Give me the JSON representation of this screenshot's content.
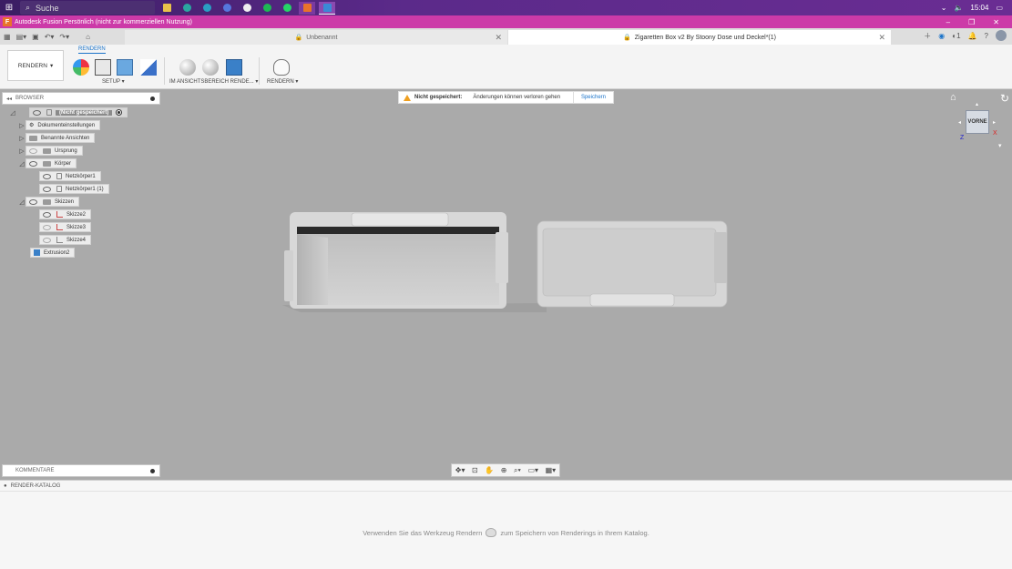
{
  "taskbar": {
    "search_placeholder": "Suche",
    "time": "15:04"
  },
  "titlebar": {
    "title": "Autodesk Fusion Persönlich (nicht zur kommerziellen Nutzung)",
    "logo_letter": "F"
  },
  "tabs": [
    {
      "label": "Unbenannt",
      "active": false
    },
    {
      "label": "Zigaretten Box v2 By Stoony Dose und Deckel*(1)",
      "active": true
    }
  ],
  "tabbar_right": {
    "notification_count": "1"
  },
  "ribbon": {
    "workspace_label": "RENDERN",
    "active_tab": "RENDERN",
    "groups": [
      {
        "label": "SETUP"
      },
      {
        "label": "IM ANSICHTSBEREICH RENDE..."
      },
      {
        "label": "RENDERN"
      }
    ]
  },
  "browser": {
    "header": "BROWSER",
    "items": [
      {
        "label": "(Nicht gespeichert)"
      },
      {
        "label": "Dokumenteinstellungen"
      },
      {
        "label": "Benannte Ansichten"
      },
      {
        "label": "Ursprung"
      },
      {
        "label": "Körper"
      },
      {
        "label": "Netzkörper1"
      },
      {
        "label": "Netzkörper1 (1)"
      },
      {
        "label": "Skizzen"
      },
      {
        "label": "Skizze2"
      },
      {
        "label": "Skizze3"
      },
      {
        "label": "Skizze4"
      },
      {
        "label": "Extrusion2"
      }
    ]
  },
  "warning": {
    "title": "Nicht gespeichert:",
    "message": "Änderungen können verloren gehen",
    "action": "Speichern"
  },
  "viewcube": {
    "face": "VORNE",
    "axis_x": "X",
    "axis_z": "Z"
  },
  "comments": {
    "label": "KOMMENTARE"
  },
  "catalog": {
    "header": "RENDER-KATALOG",
    "message_before": "Verwenden Sie das Werkzeug Rendern",
    "message_after": "zum Speichern von Renderings in Ihrem Katalog."
  },
  "colors": {
    "titlebar": "#cc3aa8",
    "taskbar": "#5b2a8a",
    "accent": "#1a73c9",
    "canvas": "#aaaaaa"
  }
}
